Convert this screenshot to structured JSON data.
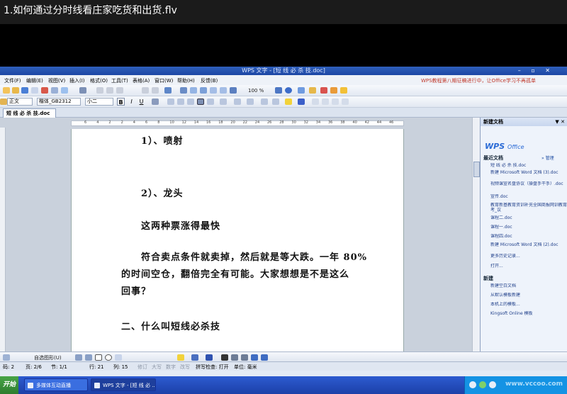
{
  "player": {
    "title": "1.如何通过分时线看庄家吃货和出货.flv"
  },
  "window": {
    "title": "WPS 文字 - [短 线 必 杀 技.doc]",
    "controls": "– ▫ ✕"
  },
  "menu": {
    "items": [
      "文件(F)",
      "编辑(E)",
      "视图(V)",
      "插入(I)",
      "格式(O)",
      "工具(T)",
      "表格(A)",
      "窗口(W)",
      "帮助(H)",
      "反馈(B)"
    ],
    "notice": "WPS教程第八期征稿进行中，让Office学习不再孤单"
  },
  "toolbar": {
    "zoom": "100 %",
    "style": "正文",
    "font": "楷体_GB2312",
    "size": "小二",
    "bold": "B",
    "italic": "I",
    "underline": "U"
  },
  "doc_tab": {
    "label": "短 线 必 杀 技.doc"
  },
  "ruler": {
    "ticks": [
      "6",
      "4",
      "2",
      "2",
      "4",
      "6",
      "8",
      "10",
      "12",
      "14",
      "16",
      "18",
      "20",
      "22",
      "24",
      "26",
      "28",
      "30",
      "32",
      "34",
      "36",
      "38",
      "40",
      "42",
      "44",
      "46"
    ]
  },
  "document": {
    "lines": [
      "1）、喷射",
      "2）、龙头",
      "这两种票涨得最快",
      "符合卖点条件就卖掉，然后就是等大跌。一年 80%",
      "的时间空仓，翻倍完全有可能。大家想想是不是这么",
      "回事？",
      "二、什么叫短线必杀技"
    ]
  },
  "taskpane": {
    "title": "新建文档",
    "close": "▼ ✕",
    "logo": "WPS",
    "logo_suffix": "Office",
    "recent_title": "最近文档",
    "manage": "» 管理",
    "recent": [
      "短 线 必 杀 技.doc",
      "新建 Microsoft Word 文档 (3).doc",
      "视频课宣名盘协议（操盘手干手）.doc",
      "宣传.doc",
      "教育新基教育资训补充全国商报网训教育考_议",
      "课程二.doc",
      "课程一.doc",
      "课程四.doc",
      "新建 Microsoft Word 文档 (2).doc"
    ],
    "more": "更多历史记录...",
    "open": "打开...",
    "new_title": "新建",
    "new_items": [
      "新建空白文档",
      "从默认模板新建",
      "本机上的模板...",
      "Kingsoft Online 模板"
    ]
  },
  "drawbar": {
    "autoshapes": "自选图形(U)"
  },
  "status": {
    "items": [
      "码: 2",
      "页: 2/6",
      "节: 1/1",
      "行: 21",
      "列: 15"
    ],
    "dim_items": [
      "修订",
      "大写",
      "数字",
      "改写"
    ],
    "spell": "拼写检查: 打开",
    "unit": "单位: 毫米"
  },
  "taskbar": {
    "start": "开始",
    "tasks": [
      "多媒体互动直播",
      "WPS 文字 - [短 线 必 ..."
    ],
    "watermark": "www.vccoo.com"
  }
}
